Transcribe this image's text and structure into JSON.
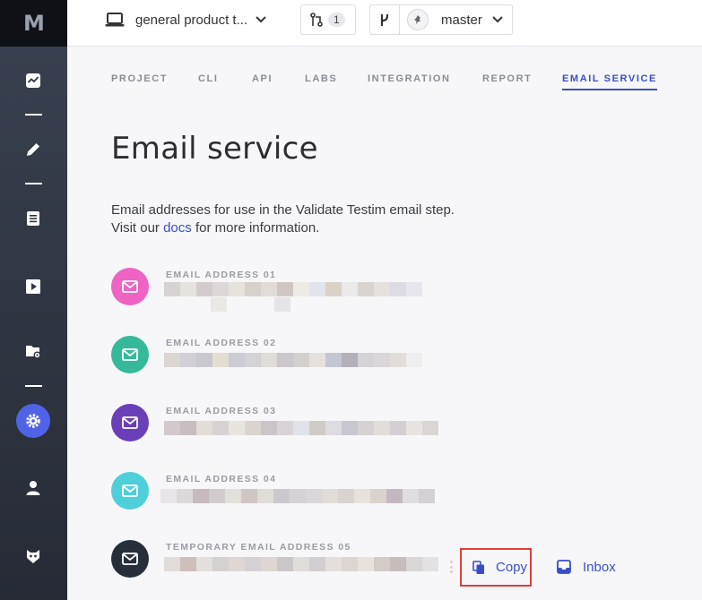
{
  "app": {
    "logo_text": "M",
    "colors": {
      "accent": "#3a4ec9",
      "active_nav": "#5063e8",
      "highlight": "#e23c3c"
    }
  },
  "sidebar": {
    "items": [
      {
        "icon": "dashboard-icon",
        "active": false
      },
      {
        "icon": "edit-icon",
        "active": false
      },
      {
        "icon": "list-icon",
        "active": false
      },
      {
        "icon": "play-icon",
        "active": false
      },
      {
        "icon": "folder-settings-icon",
        "active": false
      },
      {
        "icon": "gear-icon",
        "active": true
      },
      {
        "icon": "user-icon",
        "active": false
      },
      {
        "icon": "mascot-icon",
        "active": false
      }
    ]
  },
  "topbar": {
    "project_name": "general product t...",
    "pull_requests_count": "1",
    "branch_name": "master"
  },
  "tabs": [
    {
      "label": "PROJECT",
      "active": false
    },
    {
      "label": "CLI",
      "active": false
    },
    {
      "label": "API",
      "active": false
    },
    {
      "label": "LABS",
      "active": false
    },
    {
      "label": "INTEGRATION",
      "active": false
    },
    {
      "label": "REPORT",
      "active": false
    },
    {
      "label": "EMAIL SERVICE",
      "active": true
    }
  ],
  "page": {
    "title": "Email service",
    "description_line1": "Email addresses for use in the Validate Testim email step.",
    "description_prefix": "Visit our ",
    "description_link": "docs",
    "description_suffix": " for more information."
  },
  "emails": [
    {
      "label": "EMAIL ADDRESS 01",
      "color": "#ee63c3"
    },
    {
      "label": "EMAIL ADDRESS 02",
      "color": "#36b99b"
    },
    {
      "label": "EMAIL ADDRESS 03",
      "color": "#6a3fb8"
    },
    {
      "label": "EMAIL ADDRESS 04",
      "color": "#4fcfd9"
    },
    {
      "label": "TEMPORARY EMAIL ADDRESS 05",
      "color": "#27303a"
    }
  ],
  "actions": {
    "copy_label": "Copy",
    "inbox_label": "Inbox"
  }
}
